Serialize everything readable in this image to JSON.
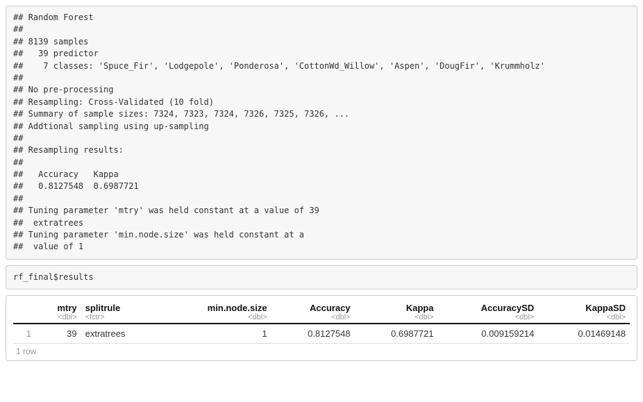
{
  "output_block": {
    "lines": [
      "## Random Forest ",
      "## ",
      "## 8139 samples",
      "##   39 predictor",
      "##    7 classes: 'Spuce_Fir', 'Lodgepole', 'Ponderosa', 'CottonWd_Willow', 'Aspen', 'DougFir', 'Krummholz' ",
      "## ",
      "## No pre-processing",
      "## Resampling: Cross-Validated (10 fold) ",
      "## Summary of sample sizes: 7324, 7323, 7324, 7326, 7325, 7326, ... ",
      "## Addtional sampling using up-sampling",
      "## ",
      "## Resampling results:",
      "## ",
      "##   Accuracy   Kappa    ",
      "##   0.8127548  0.6987721",
      "## ",
      "## Tuning parameter 'mtry' was held constant at a value of 39",
      "##  extratrees",
      "## Tuning parameter 'min.node.size' was held constant at a",
      "##  value of 1"
    ]
  },
  "code_block": {
    "code": "rf_final$results"
  },
  "results_table": {
    "columns": [
      {
        "name": "mtry",
        "type": "<dbl>",
        "align": "right"
      },
      {
        "name": "splitrule",
        "type": "<fctr>",
        "align": "left"
      },
      {
        "name": "min.node.size",
        "type": "<dbl>",
        "align": "right"
      },
      {
        "name": "Accuracy",
        "type": "<dbl>",
        "align": "right"
      },
      {
        "name": "Kappa",
        "type": "<dbl>",
        "align": "right"
      },
      {
        "name": "AccuracySD",
        "type": "<dbl>",
        "align": "right"
      },
      {
        "name": "KappaSD",
        "type": "<dbl>",
        "align": "right"
      }
    ],
    "rows": [
      {
        "index": "1",
        "mtry": "39",
        "splitrule": "extratrees",
        "min_node_size": "1",
        "Accuracy": "0.8127548",
        "Kappa": "0.6987721",
        "AccuracySD": "0.009159214",
        "KappaSD": "0.01469148"
      }
    ],
    "footer": "1 row"
  }
}
